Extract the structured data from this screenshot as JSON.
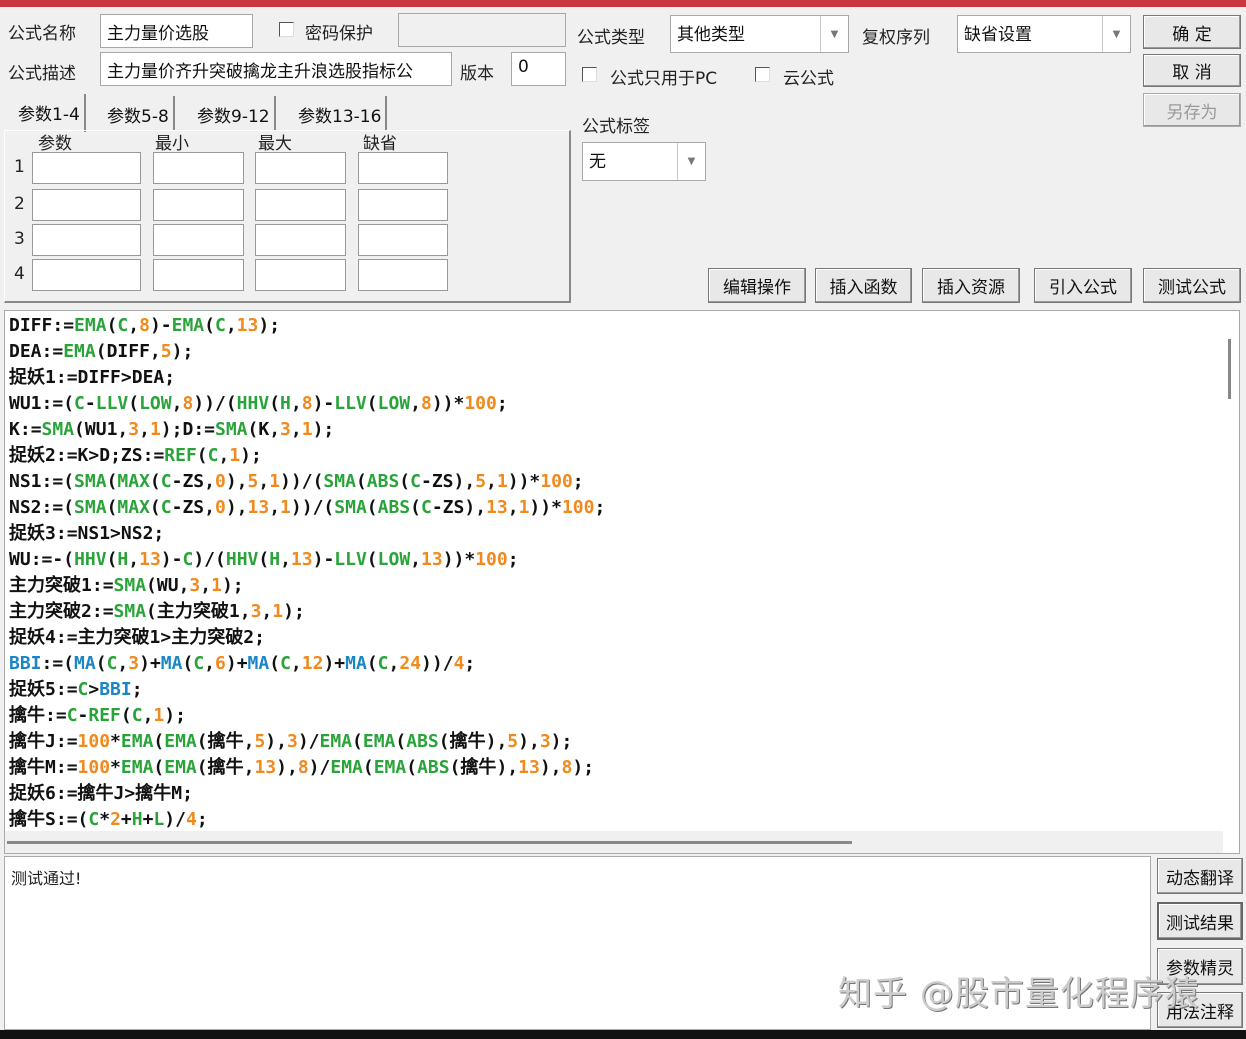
{
  "form": {
    "name_label": "公式名称",
    "name_value": "主力量价选股",
    "password_label": "密码保护",
    "password_checked": false,
    "password_value": "",
    "desc_label": "公式描述",
    "desc_value": "主力量价齐升突破擒龙主升浪选股指标公",
    "version_label": "版本",
    "version_value": "0",
    "type_label": "公式类型",
    "type_value": "其他类型",
    "fq_label": "复权序列",
    "fq_value": "缺省设置",
    "pc_only_label": "公式只用于PC",
    "cloud_label": "云公式",
    "tag_label": "公式标签",
    "tag_value": "无"
  },
  "buttons": {
    "ok": "确 定",
    "cancel": "取 消",
    "save_as": "另存为",
    "edit_ops": "编辑操作",
    "insert_func": "插入函数",
    "insert_res": "插入资源",
    "import_formula": "引入公式",
    "test_formula": "测试公式",
    "dyn_translate": "动态翻译",
    "test_result": "测试结果",
    "param_wizard": "参数精灵",
    "usage_notes": "用法注释"
  },
  "params": {
    "tabs": [
      "参数1-4",
      "参数5-8",
      "参数9-12",
      "参数13-16"
    ],
    "headers": [
      "参数",
      "最小",
      "最大",
      "缺省"
    ],
    "rows": [
      "1",
      "2",
      "3",
      "4"
    ]
  },
  "code_lines": [
    "DIFF:=EMA(C,8)-EMA(C,13);",
    "DEA:=EMA(DIFF,5);",
    "捉妖1:=DIFF>DEA;",
    "WU1:=(C-LLV(LOW,8))/(HHV(H,8)-LLV(LOW,8))*100;",
    "K:=SMA(WU1,3,1);D:=SMA(K,3,1);",
    "捉妖2:=K>D;ZS:=REF(C,1);",
    "NS1:=(SMA(MAX(C-ZS,0),5,1))/(SMA(ABS(C-ZS),5,1))*100;",
    "NS2:=(SMA(MAX(C-ZS,0),13,1))/(SMA(ABS(C-ZS),13,1))*100;",
    "捉妖3:=NS1>NS2;",
    "WU:=-(HHV(H,13)-C)/(HHV(H,13)-LLV(LOW,13))*100;",
    "主力突破1:=SMA(WU,3,1);",
    "主力突破2:=SMA(主力突破1,3,1);",
    "捉妖4:=主力突破1>主力突破2;",
    "BBI:=(MA(C,3)+MA(C,6)+MA(C,12)+MA(C,24))/4;",
    "捉妖5:=C>BBI;",
    "擒牛:=C-REF(C,1);",
    "擒牛J:=100*EMA(EMA(擒牛,5),3)/EMA(EMA(ABS(擒牛),5),3);",
    "擒牛M:=100*EMA(EMA(擒牛,13),8)/EMA(EMA(ABS(擒牛),13),8);",
    "捉妖6:=擒牛J>擒牛M;",
    "擒牛S:=(C*2+H+L)/4;"
  ],
  "output_text": "测试通过!",
  "watermark": "知乎 @股市量化程序猿",
  "colors": {
    "function": "#2aa43a",
    "number": "#f08a1e",
    "ma": "#1a86c8",
    "title_bar": "#c8383e"
  }
}
